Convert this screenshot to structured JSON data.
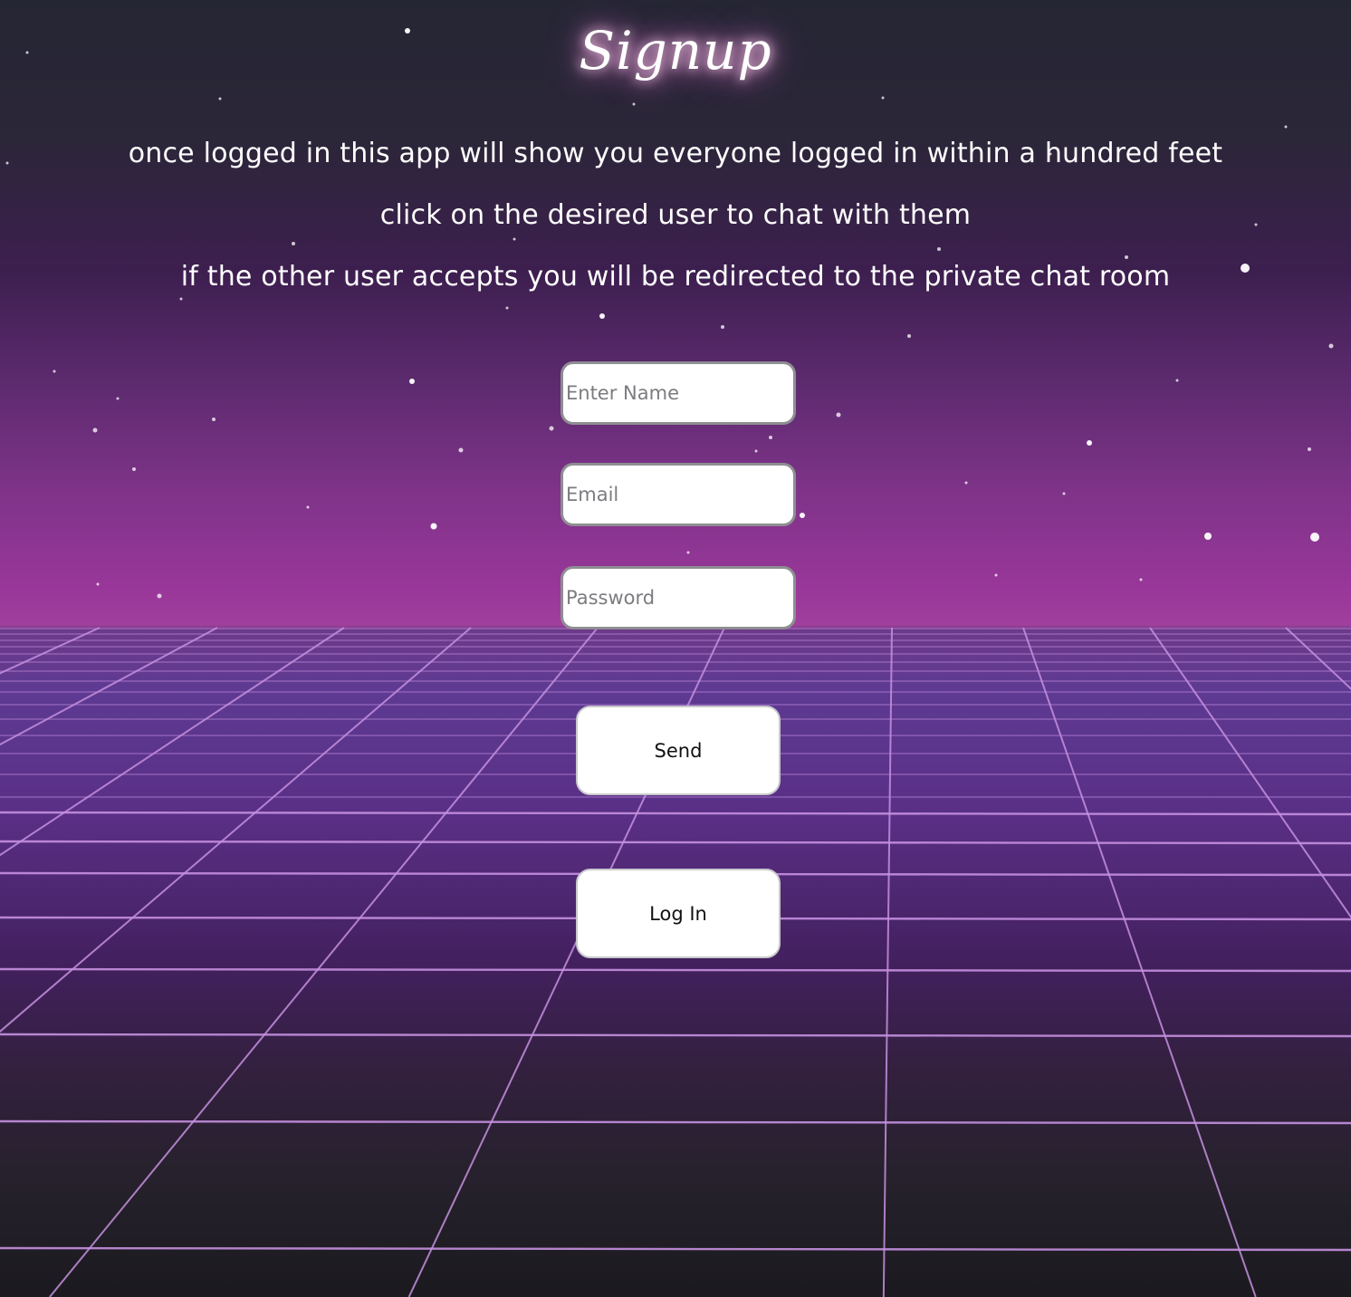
{
  "page": {
    "title": "Signup",
    "description_lines": [
      "once logged in this app will show you everyone logged in within a hundred feet",
      "click on the desired user to chat with them",
      "if the other user accepts you will be redirected to the private chat room"
    ]
  },
  "form": {
    "name_placeholder": "Enter Name",
    "email_placeholder": "Email",
    "password_placeholder": "Password",
    "send_label": "Send",
    "login_label": "Log In"
  },
  "theme": {
    "sky_top": "#252634",
    "horizon_magenta": "#a03f9c",
    "grid_line": "#c690e0",
    "floor_dark": "#1b1a1f",
    "title_glow": "#e88ad2"
  }
}
